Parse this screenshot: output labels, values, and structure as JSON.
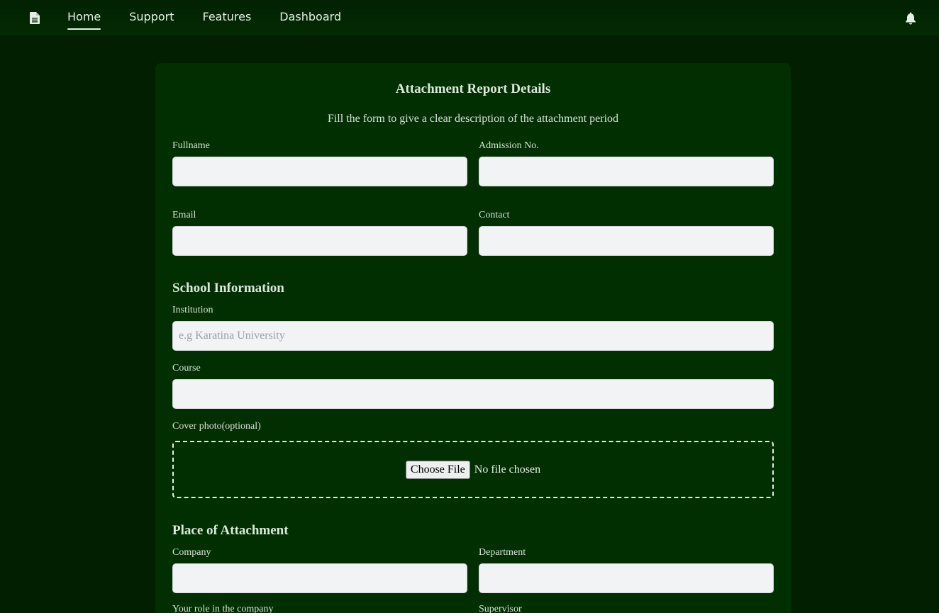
{
  "nav": {
    "links": [
      {
        "label": "Home",
        "active": true
      },
      {
        "label": "Support",
        "active": false
      },
      {
        "label": "Features",
        "active": false
      },
      {
        "label": "Dashboard",
        "active": false
      }
    ],
    "logo_icon": "document-icon",
    "notification_icon": "bell-icon"
  },
  "form": {
    "title": "Attachment Report Details",
    "subtitle": "Fill the form to give a clear description of the attachment period",
    "fields": {
      "fullname": {
        "label": "Fullname",
        "value": "",
        "placeholder": ""
      },
      "admission": {
        "label": "Admission No.",
        "value": "",
        "placeholder": ""
      },
      "email": {
        "label": "Email",
        "value": "",
        "placeholder": ""
      },
      "contact": {
        "label": "Contact",
        "value": "",
        "placeholder": ""
      },
      "institution": {
        "label": "Institution",
        "value": "",
        "placeholder": "e.g Karatina University"
      },
      "course": {
        "label": "Course",
        "value": "",
        "placeholder": ""
      },
      "cover_photo": {
        "label": "Cover photo(optional)",
        "button": "Choose File",
        "status": "No file chosen"
      },
      "company": {
        "label": "Company",
        "value": "",
        "placeholder": ""
      },
      "department": {
        "label": "Department",
        "value": "",
        "placeholder": ""
      },
      "role": {
        "label": "Your role in the company"
      },
      "supervisor": {
        "label": "Supervisor"
      }
    },
    "sections": {
      "school": "School Information",
      "attachment": "Place of Attachment"
    }
  },
  "colors": {
    "background": "#021f02",
    "card": "#012f01",
    "input_bg": "#f2f3f5",
    "text": "#e4ece4"
  }
}
